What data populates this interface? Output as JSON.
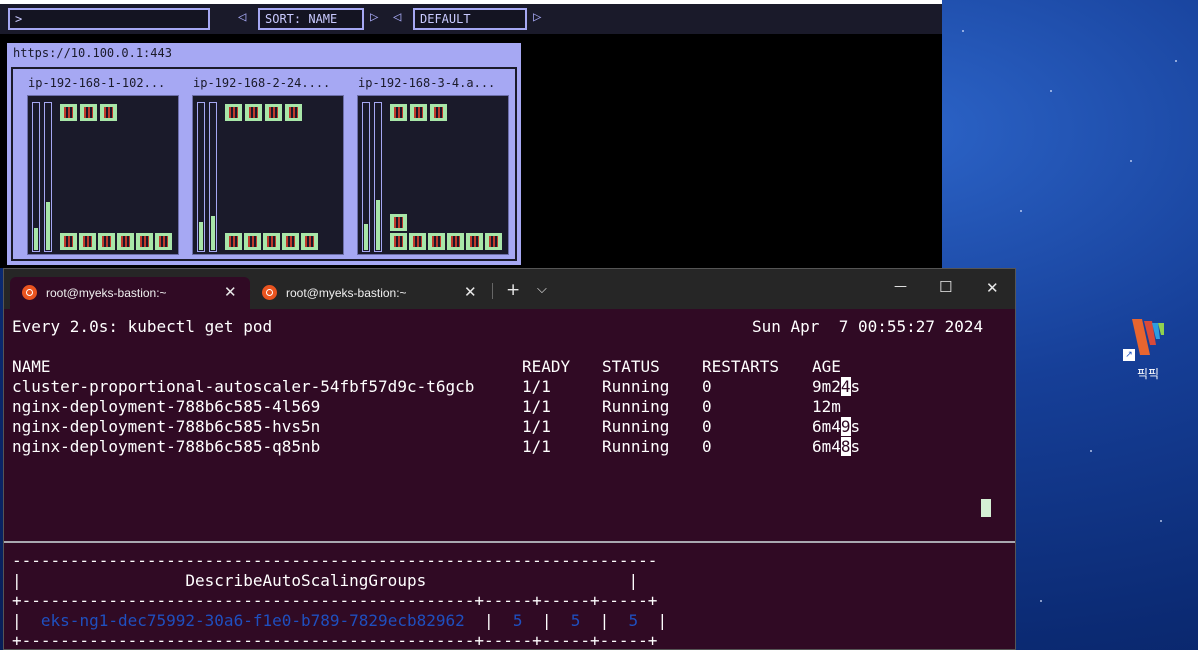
{
  "kube_ops_view": {
    "filter_value": ">",
    "sort_label": "SORT: NAME",
    "theme_label": "DEFAULT",
    "cluster_url": "https://10.100.0.1:443",
    "nodes": [
      {
        "label": "ip-192-168-1-102..."
      },
      {
        "label": "ip-192-168-2-24...."
      },
      {
        "label": "ip-192-168-3-4.a..."
      }
    ]
  },
  "terminal": {
    "tabs": [
      {
        "label": "root@myeks-bastion:~",
        "active": true
      },
      {
        "label": "root@myeks-bastion:~",
        "active": false
      }
    ],
    "new_tab_symbol": "+",
    "dropdown_symbol": "⌵",
    "minimize_symbol": "—",
    "maximize_symbol": "☐",
    "close_symbol": "✕",
    "watch_header": "Every 2.0s: kubectl get pod",
    "watch_time": "Sun Apr  7 00:55:27 2024",
    "columns": [
      "NAME",
      "READY",
      "STATUS",
      "RESTARTS",
      "AGE"
    ],
    "rows": [
      {
        "name": "cluster-proportional-autoscaler-54fbf57d9c-t6gcb",
        "ready": "1/1",
        "status": "Running",
        "restarts": "0",
        "age_a": "9m2",
        "age_hl": "4",
        "age_b": "s"
      },
      {
        "name": "nginx-deployment-788b6c585-4l569",
        "ready": "1/1",
        "status": "Running",
        "restarts": "0",
        "age_a": "12m",
        "age_hl": "",
        "age_b": ""
      },
      {
        "name": "nginx-deployment-788b6c585-hvs5n",
        "ready": "1/1",
        "status": "Running",
        "restarts": "0",
        "age_a": "6m4",
        "age_hl": "9",
        "age_b": "s"
      },
      {
        "name": "nginx-deployment-788b6c585-q85nb",
        "ready": "1/1",
        "status": "Running",
        "restarts": "0",
        "age_a": "6m4",
        "age_hl": "8",
        "age_b": "s"
      }
    ],
    "asg": {
      "dash_top": "-------------------------------------------------------------------",
      "title": "DescribeAutoScalingGroups",
      "dash_mid": "+-----------------------------------------------+-----+-----+-----+",
      "group_name": "eks-ng1-dec75992-30a6-f1e0-b789-7829ecb82962",
      "min": "5",
      "max": "5",
      "desired": "5",
      "dash_bottom": "+-----------------------------------------------+-----+-----+-----+"
    }
  },
  "desktop": {
    "icon_label": "픽픽",
    "shortcut_arrow": "↗"
  },
  "colors": {
    "terminal_bg": "#300a24",
    "kube_accent": "#a6a8f3",
    "pod_green": "#a8e6a8",
    "asg_text": "#1f4fbf"
  }
}
